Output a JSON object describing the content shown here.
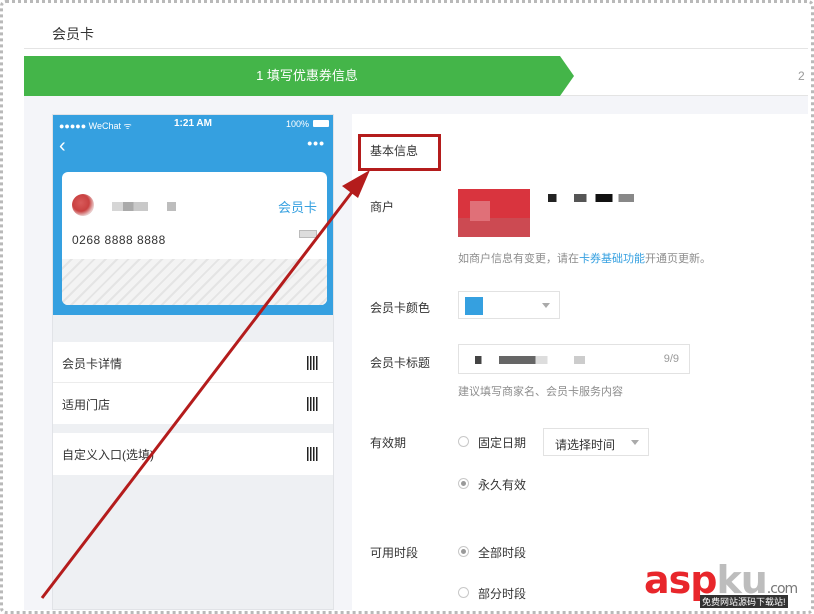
{
  "page": {
    "title": "会员卡"
  },
  "steps": {
    "active_label": "1 填写优惠券信息",
    "next_label": "2"
  },
  "phone": {
    "carrier": "●●●●● WeChat ᯤ",
    "time": "1:21 AM",
    "battery": "100%",
    "card": {
      "type_label": "会员卡",
      "number": "0268 8888 8888"
    },
    "list_1": [
      {
        "label": "会员卡详情"
      },
      {
        "label": "适用门店"
      }
    ],
    "list_2": [
      {
        "label": "自定义入口(选填)"
      }
    ]
  },
  "form": {
    "section_title": "基本信息",
    "merchant": {
      "label": "商户",
      "hint_before": "如商户信息有变更，请在",
      "hint_link": "卡券基础功能",
      "hint_after": "开通页更新。"
    },
    "color": {
      "label": "会员卡颜色",
      "value": "#35a0e0"
    },
    "card_title": {
      "label": "会员卡标题",
      "counter": "9/9",
      "hint": "建议填写商家名、会员卡服务内容"
    },
    "validity": {
      "label": "有效期",
      "fixed_label": "固定日期",
      "select_placeholder": "请选择时间",
      "forever_label": "永久有效",
      "selected": "永久有效"
    },
    "period": {
      "label": "可用时段",
      "all_label": "全部时段",
      "partial_label": "部分时段",
      "selected": "全部时段"
    }
  },
  "colors": {
    "accent_green": "#44b549",
    "brand_blue": "#35a0e0",
    "annotation_red": "#b41c1c"
  },
  "watermark": {
    "asp": "asp",
    "ku": "ku",
    "domain": ".com",
    "subtitle": "免费网站源码下载站!"
  }
}
